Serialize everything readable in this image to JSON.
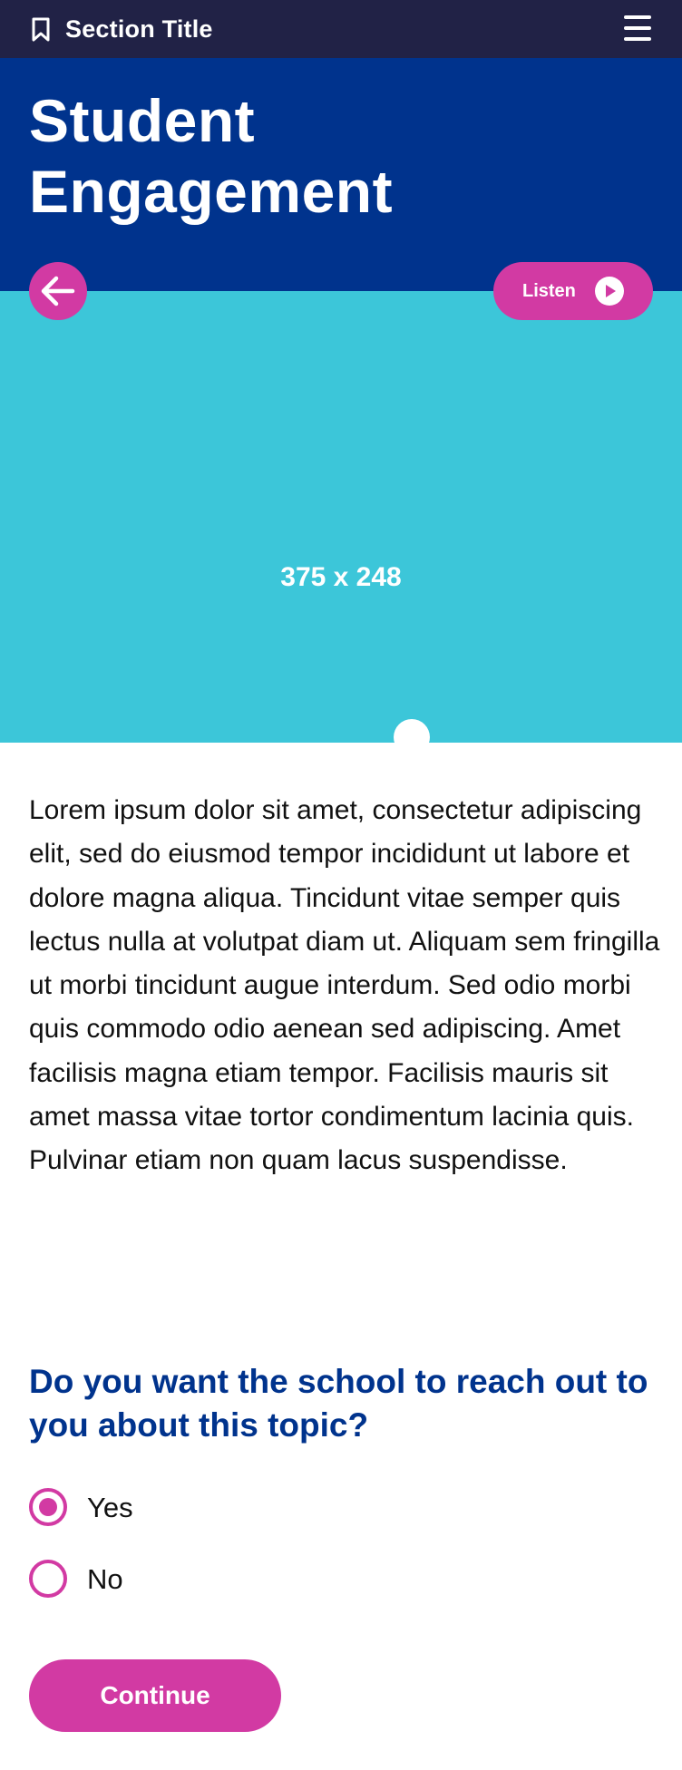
{
  "header": {
    "section_title": "Section Title",
    "bookmark_icon": "bookmark-icon",
    "menu_icon": "hamburger-menu-icon"
  },
  "hero": {
    "title": "Student Engagement",
    "back_icon": "arrow-left-icon",
    "listen_label": "Listen",
    "listen_icon": "play-circle-icon"
  },
  "media": {
    "placeholder_icon": "image-placeholder-icon",
    "placeholder_label": "375 x 248"
  },
  "content": {
    "body": "Lorem ipsum dolor sit amet, consectetur adipiscing elit, sed do eiusmod tempor incididunt ut labore et dolore magna aliqua. Tincidunt vitae semper quis lectus nulla at volutpat diam ut. Aliquam sem fringilla ut morbi tincidunt augue interdum. Sed odio morbi quis commodo odio aenean sed adipiscing. Amet facilisis magna etiam tempor. Facilisis mauris sit amet massa vitae tortor condimentum lacinia quis. Pulvinar etiam non quam lacus suspendisse."
  },
  "question": {
    "text": "Do you want the school to reach out to you about this topic?",
    "options": [
      {
        "label": "Yes",
        "selected": true
      },
      {
        "label": "No",
        "selected": false
      }
    ]
  },
  "actions": {
    "continue_label": "Continue"
  },
  "colors": {
    "topbar": "#212246",
    "hero": "#00338d",
    "media": "#3cc6d9",
    "accent": "#d23aa3",
    "question": "#00338d"
  }
}
